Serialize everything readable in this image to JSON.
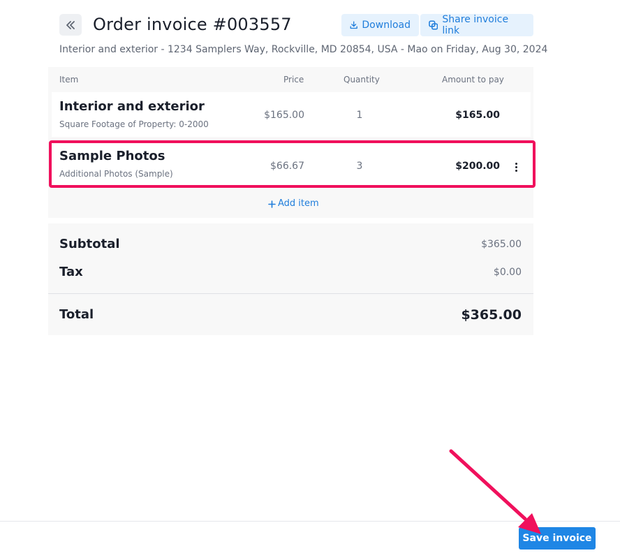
{
  "header": {
    "back_icon": "double-chevron-left-icon",
    "title": "Order invoice #003557",
    "download_label": "Download",
    "download_icon": "download-icon",
    "share_label": "Share invoice link",
    "share_icon": "link-icon",
    "subtitle": "Interior and exterior - 1234 Samplers Way, Rockville, MD 20854, USA - Mao on Friday, Aug 30, 2024"
  },
  "table": {
    "columns": [
      "Item",
      "Price",
      "Quantity",
      "Amount to pay"
    ],
    "rows": [
      {
        "name": "Interior and exterior",
        "description": "Square Footage of Property: 0-2000",
        "price": "$165.00",
        "quantity": "1",
        "amount": "$165.00"
      },
      {
        "name": "Sample Photos",
        "description": "Additional Photos (Sample)",
        "price": "$66.67",
        "quantity": "3",
        "amount": "$200.00"
      }
    ],
    "add_item_label": "Add item"
  },
  "totals": {
    "subtotal_label": "Subtotal",
    "subtotal_value": "$365.00",
    "tax_label": "Tax",
    "tax_value": "$0.00",
    "total_label": "Total",
    "total_value": "$365.00"
  },
  "footer": {
    "save_label": "Save invoice"
  },
  "colors": {
    "accent": "#1f86e5",
    "highlight": "#f0105c",
    "button_bg_light": "#e6f2fd"
  }
}
